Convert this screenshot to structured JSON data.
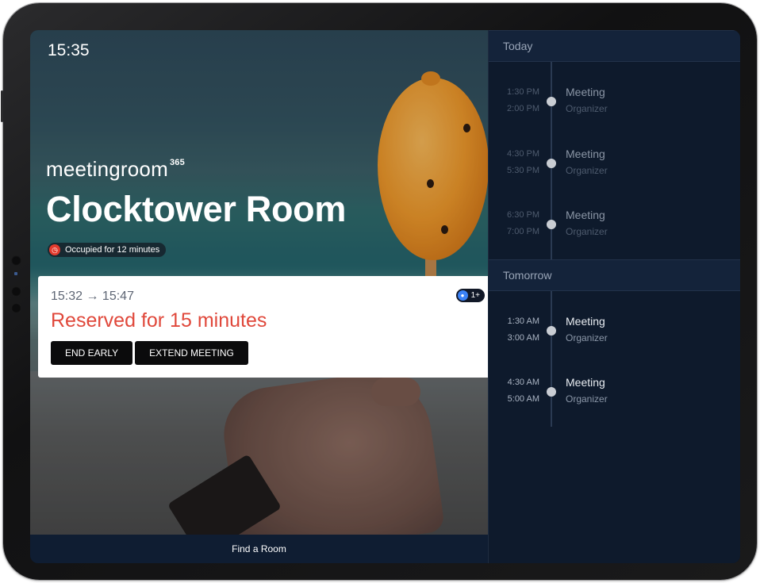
{
  "header": {
    "clock": "15:35"
  },
  "brand": {
    "name": "meetingroom",
    "superscript": "365"
  },
  "room": {
    "name": "Clocktower Room",
    "status": "Occupied for 12 minutes",
    "status_color": "#e23b2e"
  },
  "current_meeting": {
    "time_range": "15:32 → 15:47",
    "reserved_text": "Reserved for 15 minutes",
    "attendees_badge": "1+",
    "end_early_label": "END EARLY",
    "extend_label": "EXTEND MEETING",
    "accent_color": "#e0483b"
  },
  "footer": {
    "find_room_label": "Find a Room"
  },
  "schedule": {
    "days": [
      {
        "label": "Today",
        "events": [
          {
            "start": "1:30 PM",
            "end": "2:00 PM",
            "title": "Meeting",
            "organizer": "Organizer",
            "state": "past"
          },
          {
            "start": "4:30 PM",
            "end": "5:30 PM",
            "title": "Meeting",
            "organizer": "Organizer",
            "state": "past"
          },
          {
            "start": "6:30 PM",
            "end": "7:00 PM",
            "title": "Meeting",
            "organizer": "Organizer",
            "state": "past"
          }
        ]
      },
      {
        "label": "Tomorrow",
        "events": [
          {
            "start": "1:30 AM",
            "end": "3:00 AM",
            "title": "Meeting",
            "organizer": "Organizer",
            "state": "future"
          },
          {
            "start": "4:30 AM",
            "end": "5:00 AM",
            "title": "Meeting",
            "organizer": "Organizer",
            "state": "future"
          }
        ]
      }
    ]
  }
}
